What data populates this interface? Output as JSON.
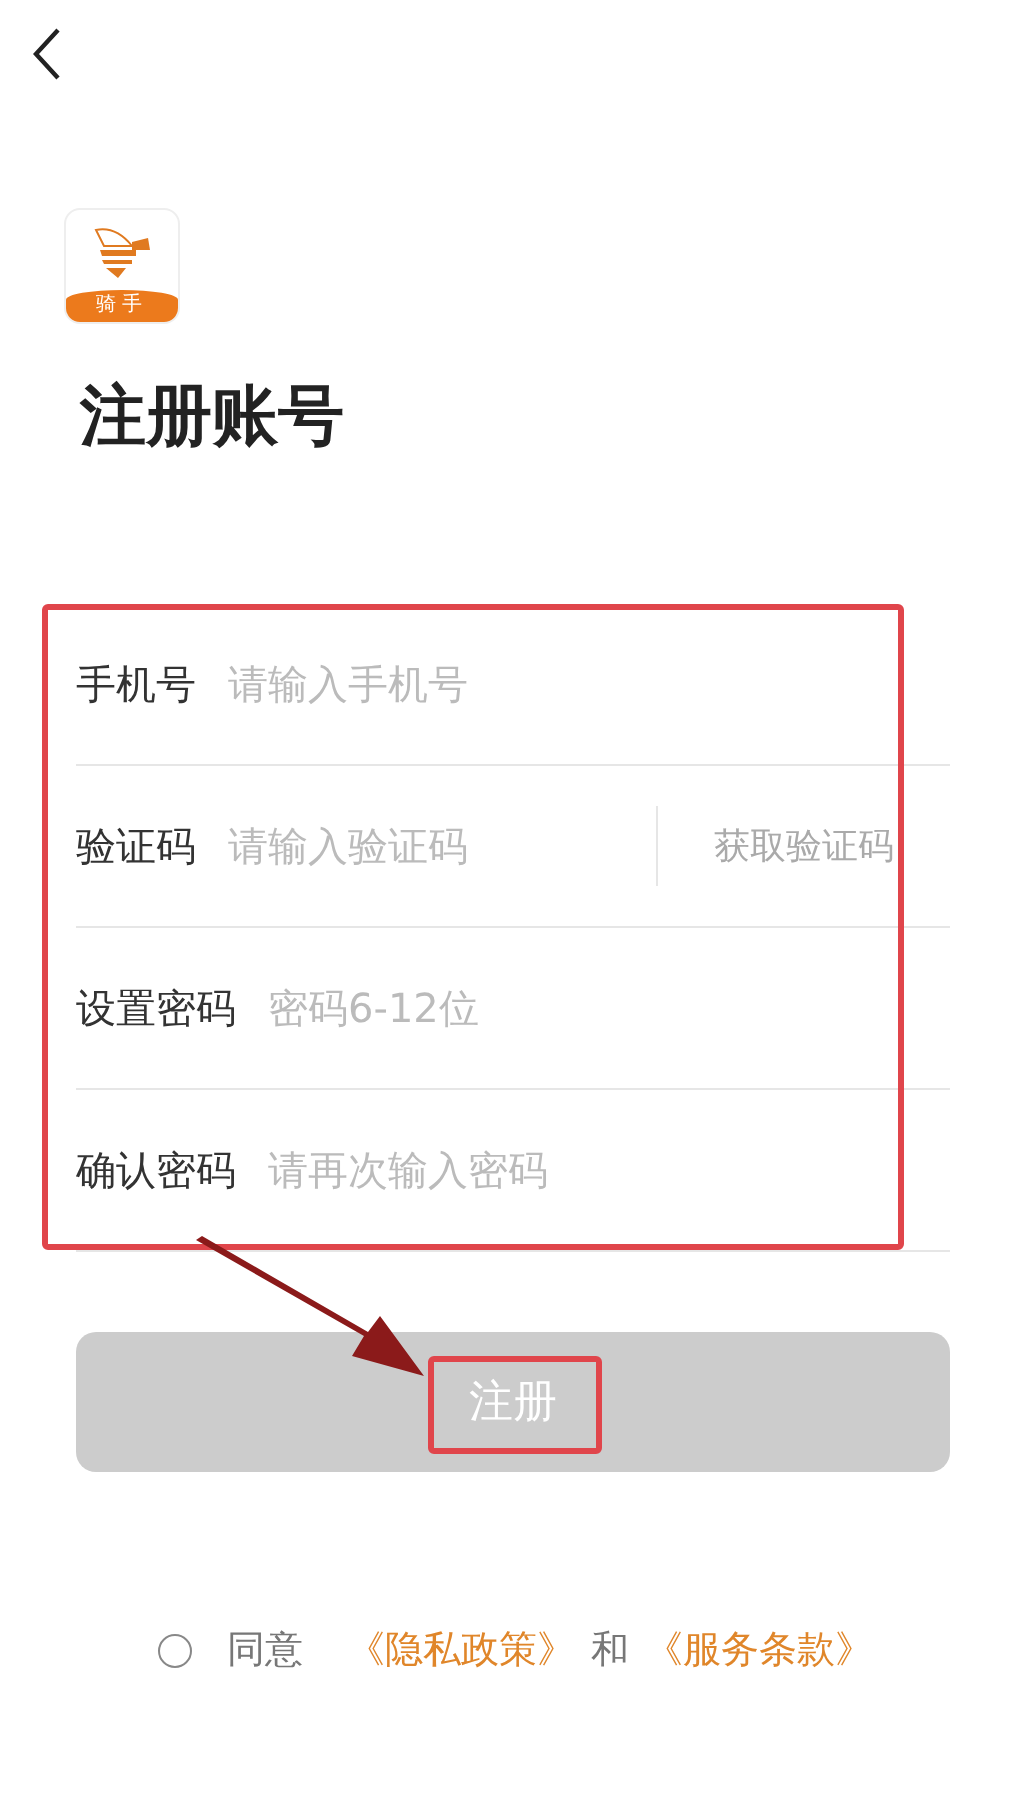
{
  "logo": {
    "label": "骑手"
  },
  "title": "注册账号",
  "fields": [
    {
      "kind": "text",
      "label": "手机号",
      "placeholder": "请输入手机号"
    },
    {
      "kind": "code",
      "label": "验证码",
      "placeholder": "请输入验证码",
      "action": "获取验证码"
    },
    {
      "kind": "text",
      "label": "设置密码",
      "placeholder": "密码6-12位"
    },
    {
      "kind": "text",
      "label": "确认密码",
      "placeholder": "请再次输入密码"
    }
  ],
  "submit": {
    "label": "注册",
    "disabled": true
  },
  "agreement": {
    "checked": false,
    "prefix": "同意",
    "links": [
      "《隐私政策》",
      "《服务条款》"
    ],
    "joiner": "和"
  }
}
